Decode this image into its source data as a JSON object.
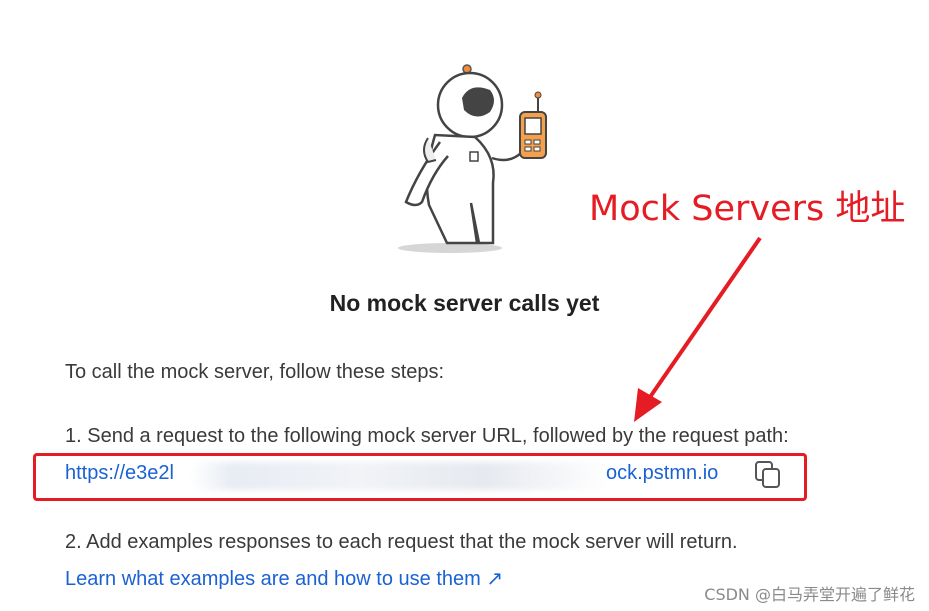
{
  "empty_state": {
    "title": "No mock server calls yet",
    "intro": "To call the mock server, follow these steps:",
    "step1": "1. Send a request to the following mock server URL, followed by the request path:",
    "url_start": "https://e3e2l",
    "url_end": "ock.pstmn.io",
    "step2": "2. Add examples responses to each request that the mock server will return.",
    "learn_link": "Learn what examples are and how to use them ↗"
  },
  "annotation": {
    "label": "Mock Servers 地址",
    "color": "#e51c23"
  },
  "watermark": "CSDN @白马弄堂开遍了鲜花",
  "icons": {
    "copy": "copy-icon",
    "illustration": "astronaut-with-phone-illustration"
  }
}
